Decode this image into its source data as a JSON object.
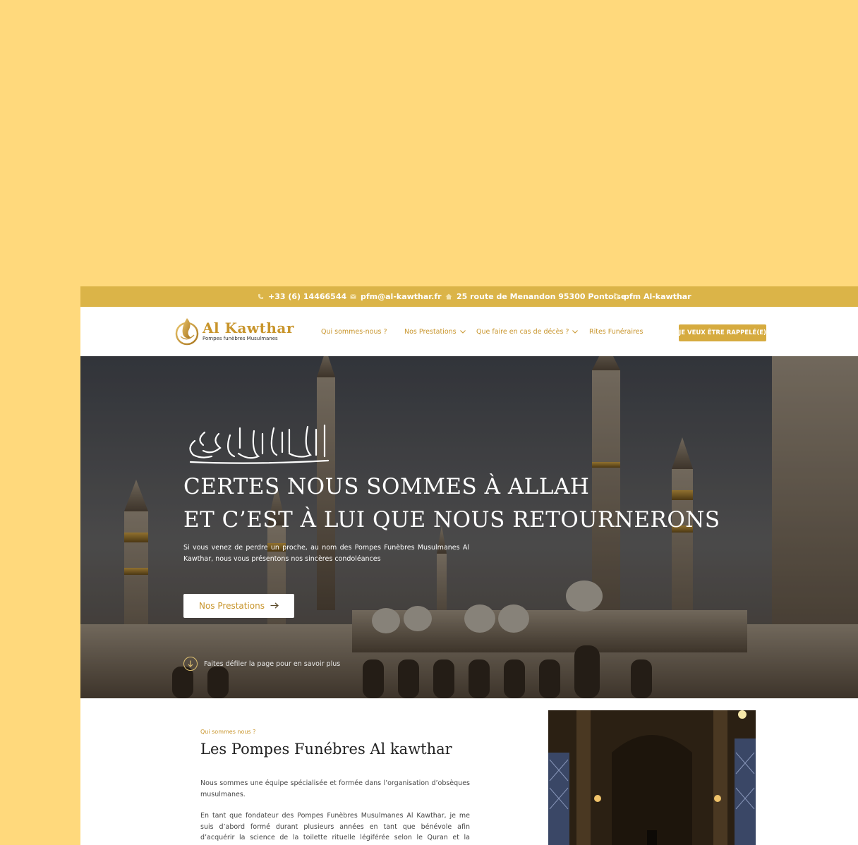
{
  "topbar": {
    "phone": "+33 (6) 14466544",
    "email": "pfm@al-kawthar.fr",
    "address": "25 route de Menandon 95300 Pontoise",
    "facebook": "pfm Al-kawthar",
    "icons": [
      "phone-icon",
      "mail-icon",
      "home-icon",
      "facebook-icon"
    ]
  },
  "brand": {
    "name": "Al Kawthar",
    "tagline": "Pompes funèbres Musulmanes",
    "color": "#c8952c"
  },
  "nav": {
    "items": [
      {
        "label": "Qui sommes-nous ?",
        "dropdown": false
      },
      {
        "label": "Nos Prestations",
        "dropdown": true
      },
      {
        "label": "Que faire en cas de décès ?",
        "dropdown": true
      },
      {
        "label": "Rites Funéraires",
        "dropdown": false
      }
    ],
    "cta": "JE VEUX ÊTRE RAPPELÉ(E)"
  },
  "hero": {
    "title_line1": "CERTES NOUS SOMMES À ALLAH",
    "title_line2": "ET C’EST À LUI QUE NOUS RETOURNERONS",
    "text": "Si vous venez de perdre un proche, au nom des Pompes Funèbres Musulmanes Al Kawthar, nous vous présentons nos sincères condoléances",
    "button": "Nos Prestations",
    "scroll_hint": "Faites défiler la page pour en savoir plus"
  },
  "about": {
    "kicker": "Qui sommes nous ?",
    "title": "Les Pompes Funébres Al kawthar",
    "p1": "Nous sommes une équipe spécialisée et formée dans l’organisation d’obsèques musulmanes.",
    "p2": "En tant que fondateur des Pompes Funèbres Musulmanes Al Kawthar, je me suis d’abord formé durant plusieurs années en tant que bénévole afin d’acquérir la science de la toilette rituelle légiférée selon le Quran et la Sounnah."
  },
  "colors": {
    "background": "#ffd97c",
    "topbar": "#dbb448",
    "accent": "#d6ab3f"
  }
}
